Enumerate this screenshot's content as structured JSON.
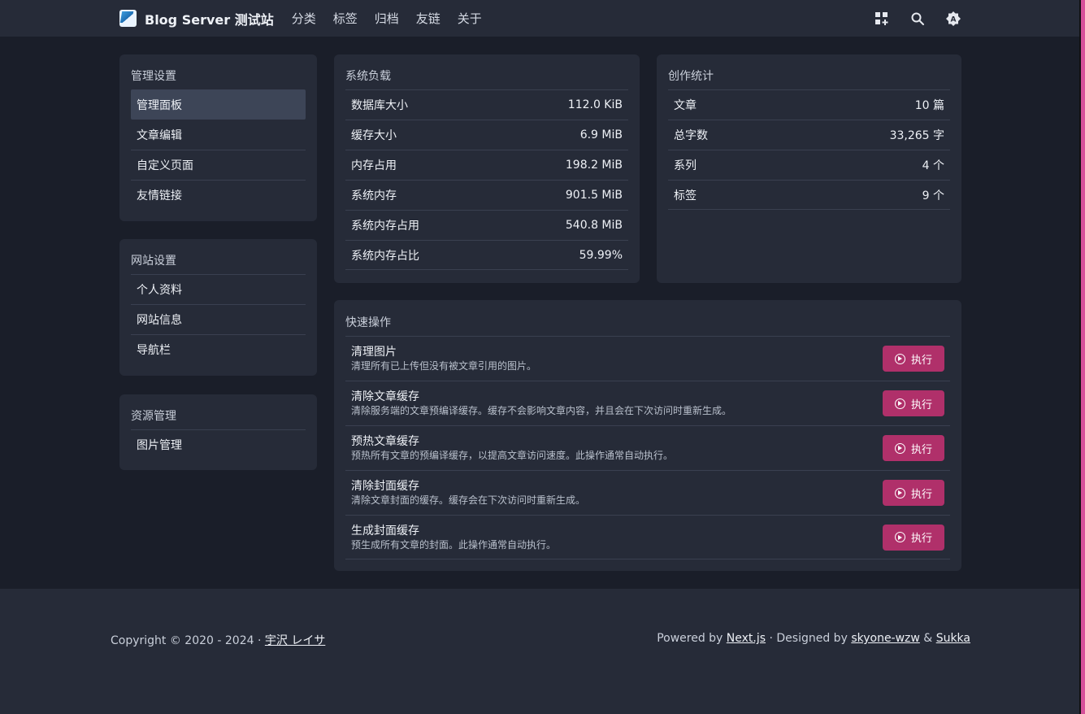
{
  "header": {
    "site_title": "Blog Server 测试站",
    "nav": [
      "分类",
      "标签",
      "归档",
      "友链",
      "关于"
    ],
    "icons": [
      "grid-plus-icon",
      "search-icon",
      "theme-toggle-icon"
    ]
  },
  "sidebar": {
    "sections": [
      {
        "title": "管理设置",
        "items": [
          "管理面板",
          "文章编辑",
          "自定义页面",
          "友情链接"
        ],
        "active": 0
      },
      {
        "title": "网站设置",
        "items": [
          "个人资料",
          "网站信息",
          "导航栏"
        ]
      },
      {
        "title": "资源管理",
        "items": [
          "图片管理"
        ]
      }
    ]
  },
  "system_load": {
    "title": "系统负载",
    "rows": [
      {
        "label": "数据库大小",
        "value": "112.0 KiB"
      },
      {
        "label": "缓存大小",
        "value": "6.9 MiB"
      },
      {
        "label": "内存占用",
        "value": "198.2 MiB"
      },
      {
        "label": "系统内存",
        "value": "901.5 MiB"
      },
      {
        "label": "系统内存占用",
        "value": "540.8 MiB"
      },
      {
        "label": "系统内存占比",
        "value": "59.99%"
      }
    ]
  },
  "creation_stats": {
    "title": "创作统计",
    "rows": [
      {
        "label": "文章",
        "value": "10 篇"
      },
      {
        "label": "总字数",
        "value": "33,265 字"
      },
      {
        "label": "系列",
        "value": "4 个"
      },
      {
        "label": "标签",
        "value": "9 个"
      }
    ]
  },
  "quick_ops": {
    "title": "快速操作",
    "button_label": "执行",
    "items": [
      {
        "title": "清理图片",
        "desc": "清理所有已上传但没有被文章引用的图片。"
      },
      {
        "title": "清除文章缓存",
        "desc": "清除服务端的文章预编译缓存。缓存不会影响文章内容，并且会在下次访问时重新生成。"
      },
      {
        "title": "预热文章缓存",
        "desc": "预热所有文章的预编译缓存，以提高文章访问速度。此操作通常自动执行。"
      },
      {
        "title": "清除封面缓存",
        "desc": "清除文章封面的缓存。缓存会在下次访问时重新生成。"
      },
      {
        "title": "生成封面缓存",
        "desc": "预生成所有文章的封面。此操作通常自动执行。"
      }
    ]
  },
  "footer": {
    "copyright_prefix": "Copyright © 2020 - 2024 · ",
    "author": "宇沢 レイサ",
    "powered_prefix": "Powered by ",
    "nextjs": "Next.js",
    "designed_prefix": " · Designed by ",
    "designer1": "skyone-wzw",
    "amp": " & ",
    "designer2": "Sukka"
  },
  "colors": {
    "accent": "#b0306a",
    "background": "#1a1e29",
    "card": "#262b38",
    "edge": "#d6519a"
  }
}
